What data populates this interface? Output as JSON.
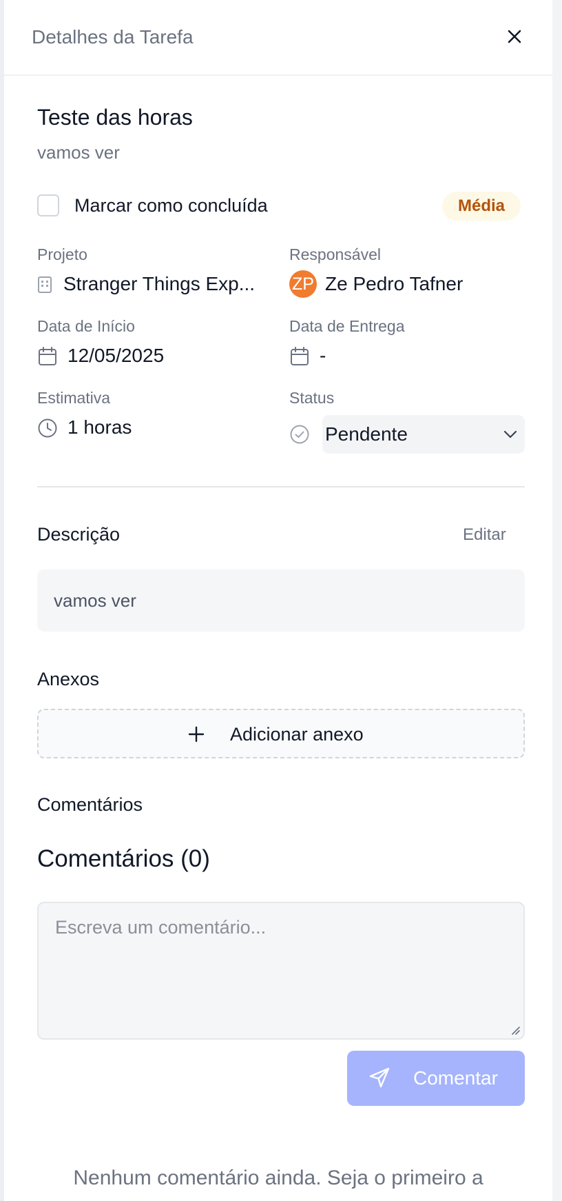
{
  "header": {
    "title": "Detalhes da Tarefa"
  },
  "task": {
    "title": "Teste das horas",
    "subtitle": "vamos ver",
    "complete_label": "Marcar como concluída",
    "priority": "Média"
  },
  "fields": {
    "project_label": "Projeto",
    "project_value": "Stranger Things Exp...",
    "assignee_label": "Responsável",
    "assignee_initials": "ZP",
    "assignee_value": "Ze Pedro Tafner",
    "start_label": "Data de Início",
    "start_value": "12/05/2025",
    "due_label": "Data de Entrega",
    "due_value": "-",
    "estimate_label": "Estimativa",
    "estimate_value": "1 horas",
    "status_label": "Status",
    "status_value": "Pendente"
  },
  "description": {
    "title": "Descrição",
    "edit_label": "Editar",
    "text": "vamos ver"
  },
  "attachments": {
    "title": "Anexos",
    "add_label": "Adicionar anexo"
  },
  "comments": {
    "section_title": "Comentários",
    "heading": "Comentários (0)",
    "placeholder": "Escreva um comentário...",
    "submit_label": "Comentar",
    "empty_message": "Nenhum comentário ainda. Seja o primeiro a"
  },
  "colors": {
    "priority_bg": "#fef8e6",
    "priority_text": "#b45309",
    "avatar": "#ef7c2f",
    "submit_disabled": "#a5b4fc"
  },
  "icons": [
    "close-icon",
    "building-icon",
    "calendar-icon",
    "clock-icon",
    "check-circle-icon",
    "chevron-down-icon",
    "plus-icon",
    "send-icon"
  ]
}
